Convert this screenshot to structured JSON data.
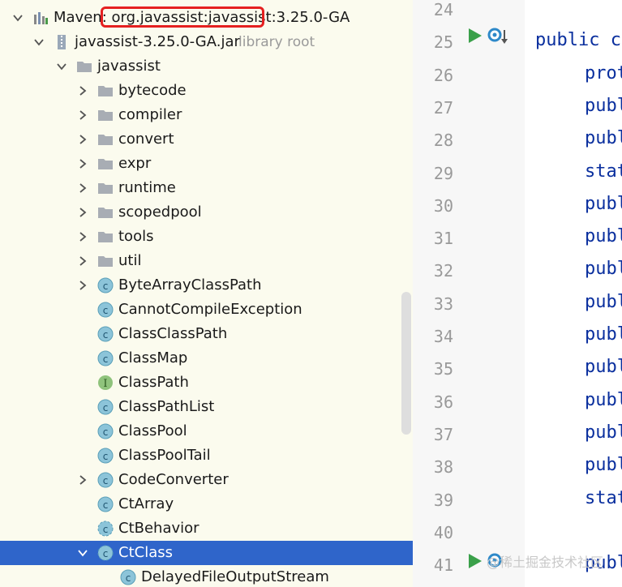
{
  "tree": {
    "rows": [
      {
        "label": "Maven: org.javassist:javassist:3.25.0-GA",
        "icon": "maven-library-icon",
        "chevron": "down",
        "indent": 0
      },
      {
        "label": "javassist-3.25.0-GA.jar",
        "suffix": "library root",
        "icon": "jar-icon",
        "chevron": "down",
        "indent": 1
      },
      {
        "label": "javassist",
        "icon": "folder-icon",
        "chevron": "down",
        "indent": 2
      },
      {
        "label": "bytecode",
        "icon": "folder-icon",
        "chevron": "right",
        "indent": 3
      },
      {
        "label": "compiler",
        "icon": "folder-icon",
        "chevron": "right",
        "indent": 3
      },
      {
        "label": "convert",
        "icon": "folder-icon",
        "chevron": "right",
        "indent": 3
      },
      {
        "label": "expr",
        "icon": "folder-icon",
        "chevron": "right",
        "indent": 3
      },
      {
        "label": "runtime",
        "icon": "folder-icon",
        "chevron": "right",
        "indent": 3
      },
      {
        "label": "scopedpool",
        "icon": "folder-icon",
        "chevron": "right",
        "indent": 3
      },
      {
        "label": "tools",
        "icon": "folder-icon",
        "chevron": "right",
        "indent": 3
      },
      {
        "label": "util",
        "icon": "folder-icon",
        "chevron": "right",
        "indent": 3
      },
      {
        "label": "ByteArrayClassPath",
        "icon": "class-icon",
        "chevron": "right",
        "indent": 3
      },
      {
        "label": "CannotCompileException",
        "icon": "class-icon",
        "chevron": "none",
        "indent": 3
      },
      {
        "label": "ClassClassPath",
        "icon": "class-icon",
        "chevron": "none",
        "indent": 3
      },
      {
        "label": "ClassMap",
        "icon": "class-icon",
        "chevron": "none",
        "indent": 3
      },
      {
        "label": "ClassPath",
        "icon": "interface-icon",
        "chevron": "none",
        "indent": 3
      },
      {
        "label": "ClassPathList",
        "icon": "class-icon",
        "chevron": "none",
        "indent": 3
      },
      {
        "label": "ClassPool",
        "icon": "class-icon",
        "chevron": "none",
        "indent": 3
      },
      {
        "label": "ClassPoolTail",
        "icon": "class-icon",
        "chevron": "none",
        "indent": 3
      },
      {
        "label": "CodeConverter",
        "icon": "class-icon",
        "chevron": "right",
        "indent": 3
      },
      {
        "label": "CtArray",
        "icon": "class-icon",
        "chevron": "none",
        "indent": 3
      },
      {
        "label": "CtBehavior",
        "icon": "abstract-class-icon",
        "chevron": "none",
        "indent": 3
      },
      {
        "label": "CtClass",
        "icon": "abstract-class-icon",
        "chevron": "down",
        "indent": 3,
        "selected": true
      },
      {
        "label": "DelayedFileOutputStream",
        "icon": "class-icon",
        "chevron": "none",
        "indent": 4
      }
    ]
  },
  "editor": {
    "lines": [
      {
        "num": "24",
        "code": ""
      },
      {
        "num": "25",
        "code": "public c"
      },
      {
        "num": "26",
        "code": "prot"
      },
      {
        "num": "27",
        "code": "publ"
      },
      {
        "num": "28",
        "code": "publ"
      },
      {
        "num": "29",
        "code": "stat"
      },
      {
        "num": "30",
        "code": "publ"
      },
      {
        "num": "31",
        "code": "publ"
      },
      {
        "num": "32",
        "code": "publ"
      },
      {
        "num": "33",
        "code": "publ"
      },
      {
        "num": "34",
        "code": "publ"
      },
      {
        "num": "35",
        "code": "publ"
      },
      {
        "num": "36",
        "code": "publ"
      },
      {
        "num": "37",
        "code": "publ"
      },
      {
        "num": "38",
        "code": "publ"
      },
      {
        "num": "39",
        "code": "stat"
      },
      {
        "num": "40",
        "code": ""
      },
      {
        "num": "41",
        "code": "publ"
      }
    ],
    "gutter_icons": [
      "run-icon",
      "override-icon"
    ]
  },
  "watermark": "@稀土掘金技术社区",
  "colors": {
    "selection": "#2f65ca",
    "tree_bg": "#fbfbee",
    "keyword": "#0a2f9e",
    "highlight": "#e52020"
  }
}
